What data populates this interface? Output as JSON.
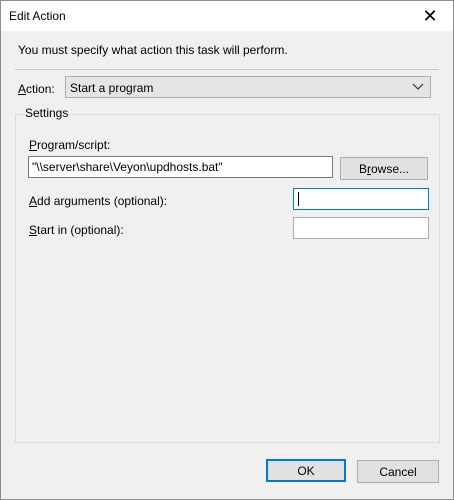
{
  "window": {
    "title": "Edit Action",
    "close_glyph": "✕"
  },
  "instruction": "You must specify what action this task will perform.",
  "action": {
    "label": "Action:",
    "value": "Start a program"
  },
  "settings": {
    "group_label": "Settings",
    "program": {
      "label": "Program/script:",
      "value": "\"\\\\server\\share\\Veyon\\updhosts.bat\""
    },
    "browse_label": "Browse...",
    "arguments": {
      "label": "Add arguments (optional):",
      "value": ""
    },
    "start_in": {
      "label": "Start in (optional):",
      "value": ""
    }
  },
  "buttons": {
    "ok": "OK",
    "cancel": "Cancel"
  },
  "colors": {
    "accent": "#0078d7",
    "dialog_bg": "#f0f0f0"
  }
}
